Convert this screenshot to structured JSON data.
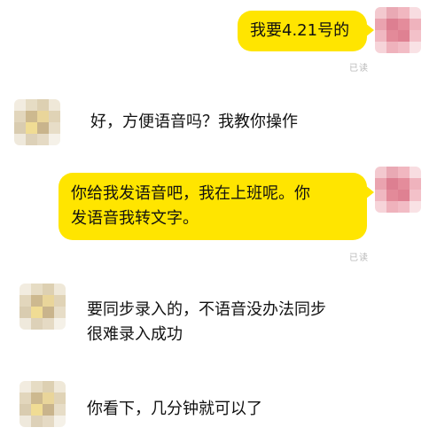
{
  "messages": [
    {
      "side": "right",
      "text": "我要4.21号的",
      "status": "已读"
    },
    {
      "side": "left",
      "text": "好，方便语音吗？我教你操作"
    },
    {
      "side": "right",
      "text_lines": [
        "你给我发语音吧，我在上班呢。你",
        "发语音我转文字。"
      ],
      "status": "已读"
    },
    {
      "side": "left",
      "text_lines": [
        "要同步录入的，不语音没办法同步",
        "很难录入成功"
      ]
    },
    {
      "side": "left",
      "text": "你看下，几分钟就可以了"
    }
  ],
  "colors": {
    "my_bubble": "#ffe500",
    "read_status": "#b8b8b8"
  },
  "icons": {
    "my_avatar": "blurred-pink-avatar-icon",
    "other_avatar": "blurred-beige-avatar-icon"
  }
}
